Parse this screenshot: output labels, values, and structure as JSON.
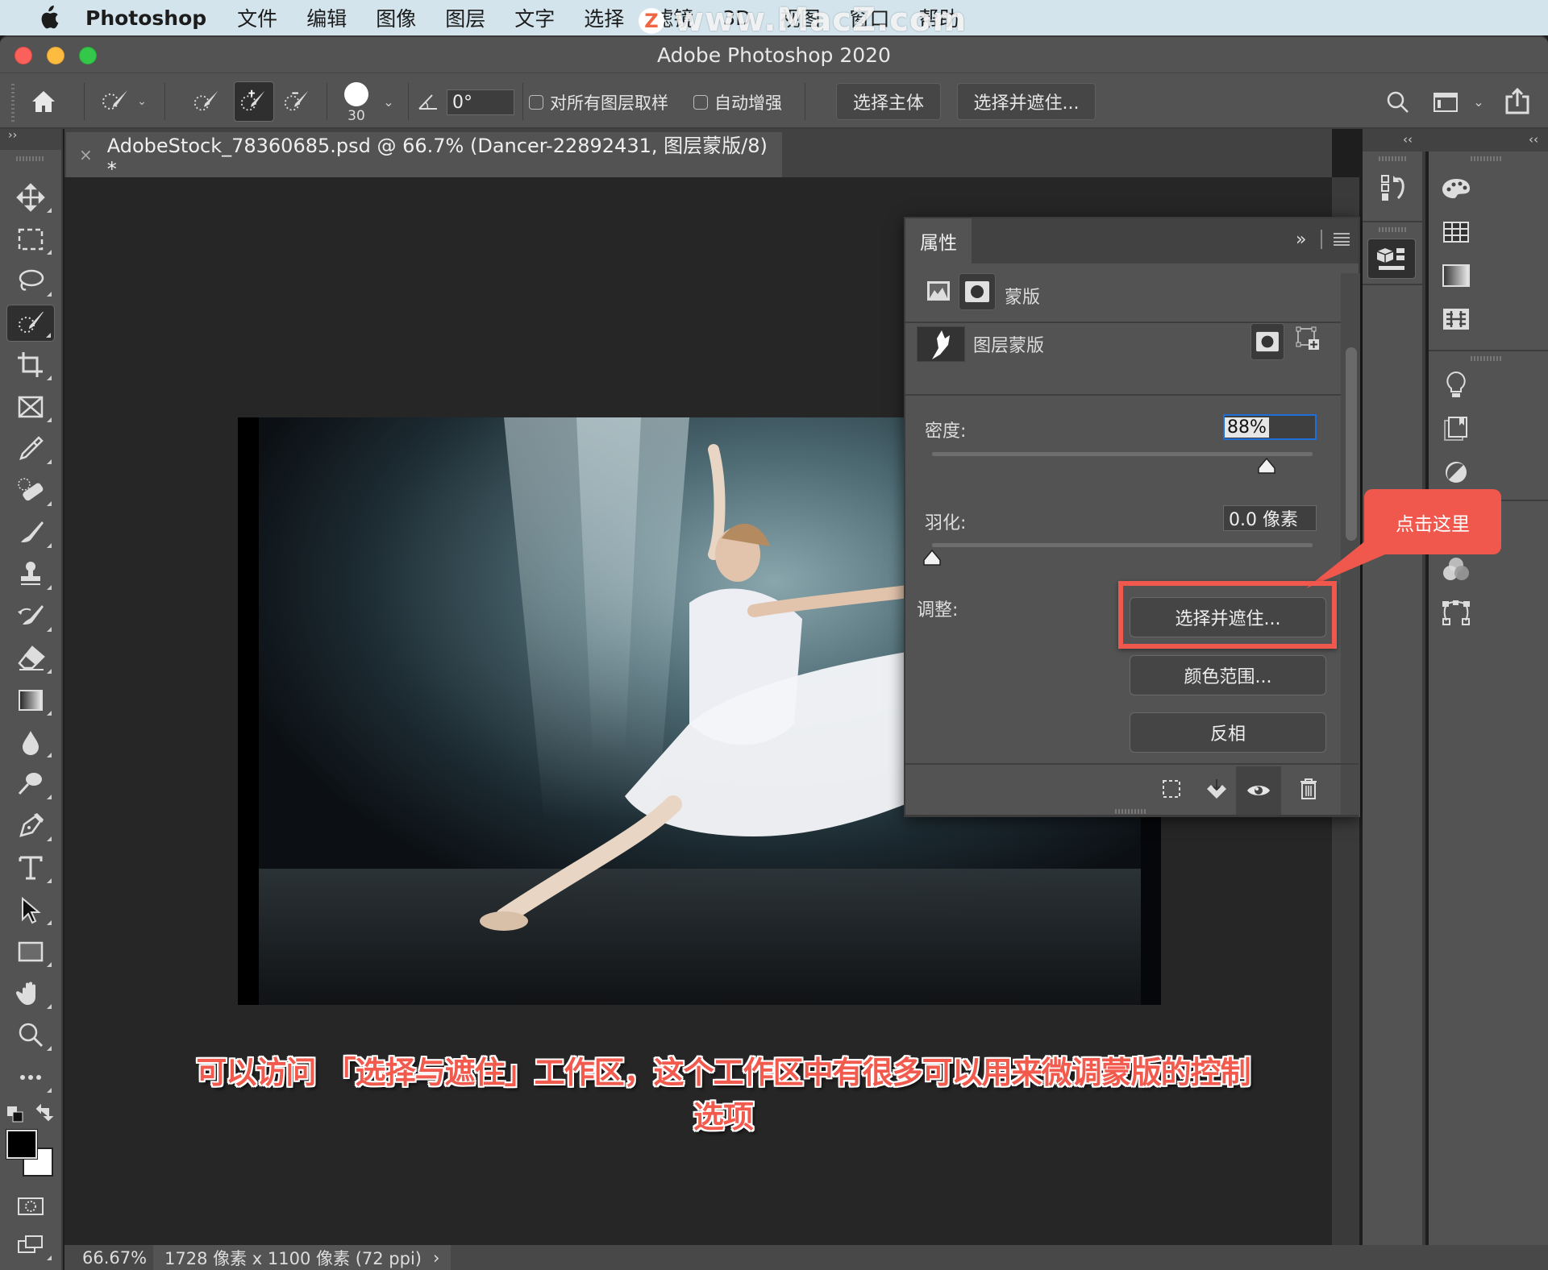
{
  "menubar": {
    "app_name": "Photoshop",
    "items": [
      "文件",
      "编辑",
      "图像",
      "图层",
      "文字",
      "选择",
      "滤镜",
      "3D",
      "视图",
      "窗口",
      "帮助"
    ],
    "watermark": "www.MacZ.com",
    "watermark_badge": "Z"
  },
  "window": {
    "title": "Adobe Photoshop 2020"
  },
  "options_bar": {
    "brush_size": "30",
    "angle_value": "0°",
    "sample_all_layers_label": "对所有图层取样",
    "sample_all_layers_checked": false,
    "auto_enhance_label": "自动增强",
    "auto_enhance_checked": false,
    "select_subject_label": "选择主体",
    "select_and_mask_label": "选择并遮住..."
  },
  "document_tab": {
    "close_glyph": "×",
    "title": "AdobeStock_78360685.psd @ 66.7% (Dancer-22892431, 图层蒙版/8) *"
  },
  "left_toolbar": {
    "collapse_glyph": "››",
    "tools": [
      "move",
      "rectangular-marquee",
      "lasso",
      "quick-selection",
      "crop",
      "frame",
      "eyedropper",
      "spot-healing-brush",
      "brush",
      "clone-stamp",
      "history-brush",
      "eraser",
      "gradient",
      "blur",
      "dodge",
      "pen",
      "type",
      "path-selection",
      "rectangle",
      "hand",
      "zoom",
      "edit-toolbar"
    ],
    "active_tool": "quick-selection",
    "foreground_color": "#000000",
    "background_color": "#ffffff"
  },
  "properties_panel": {
    "tab_label": "属性",
    "expand_glyph": "»",
    "section_label": "蒙版",
    "layer_mask_label": "图层蒙版",
    "density_label": "密度:",
    "density_value": "88%",
    "density_percent": 88,
    "feather_label": "羽化:",
    "feather_value": "0.0 像素",
    "feather_fraction": 0.0,
    "refine_label": "调整:",
    "buttons": {
      "select_and_mask": "选择并遮住...",
      "color_range": "颜色范围...",
      "invert": "反相"
    }
  },
  "annotation": {
    "callout_text": "点击这里",
    "accent_color": "#f0584d",
    "caption": "可以访问 「选择与遮住」工作区，这个工作区中有很多可以用来微调蒙版的控制选项"
  },
  "right_dock": {
    "collapse_glyph": "‹‹",
    "col1_icons": [
      "history-icon",
      "3d-icon"
    ],
    "col2_icons": [
      "color-icon",
      "swatches-icon",
      "gradients-icon",
      "patterns-icon",
      "learn-icon",
      "libraries-icon",
      "adjustments-icon",
      "channels-icon",
      "paths-icon"
    ]
  },
  "status_bar": {
    "zoom": "66.67%",
    "doc_info": "1728 像素 x 1100 像素 (72 ppi)",
    "arrow": "›"
  }
}
